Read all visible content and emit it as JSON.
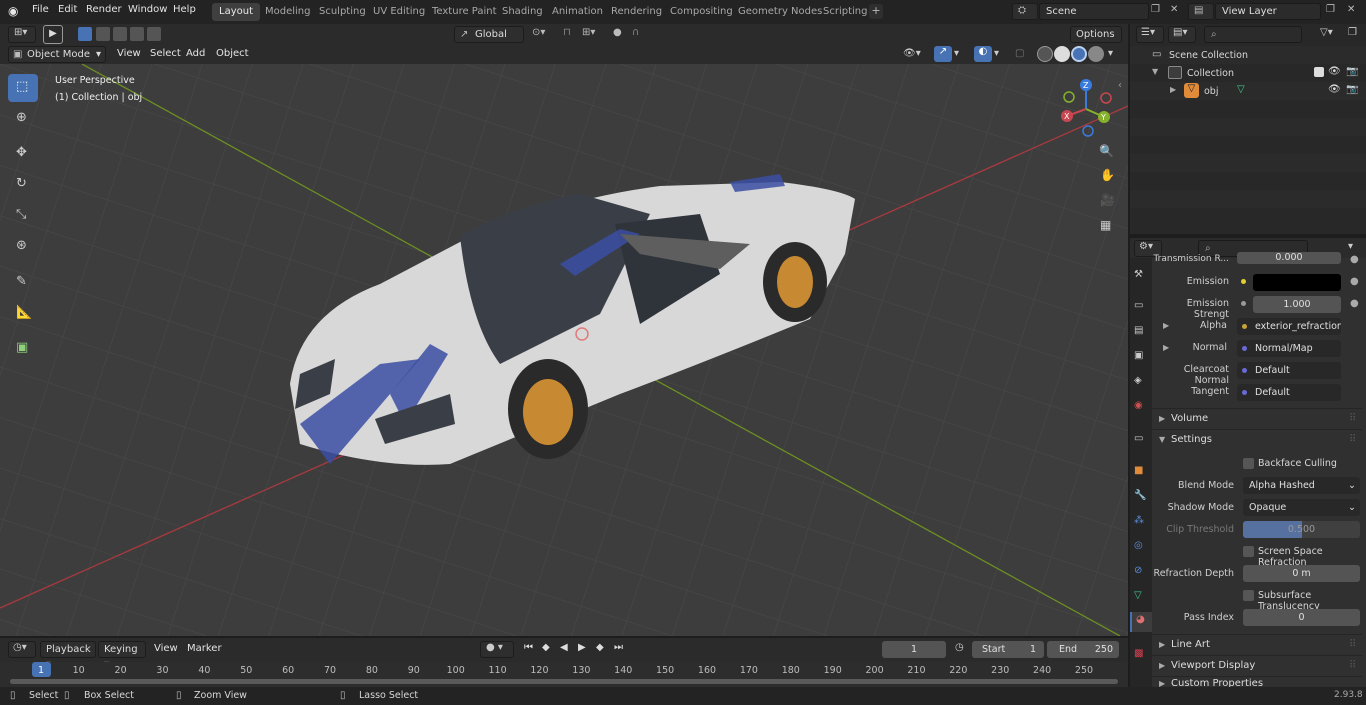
{
  "topbar": {
    "menus": [
      "File",
      "Edit",
      "Render",
      "Window",
      "Help"
    ],
    "workspaces": [
      "Layout",
      "Modeling",
      "Sculpting",
      "UV Editing",
      "Texture Paint",
      "Shading",
      "Animation",
      "Rendering",
      "Compositing",
      "Geometry Nodes",
      "Scripting"
    ],
    "active_workspace": "Layout",
    "scene": "Scene",
    "view_layer": "View Layer"
  },
  "viewport_header": {
    "mode": "Object Mode",
    "menus": [
      "View",
      "Select",
      "Add",
      "Object"
    ],
    "transform_orientation": "Global",
    "options": "Options"
  },
  "viewport": {
    "perspective_label": "User Perspective",
    "collection_label": "(1) Collection | obj",
    "gizmo_axes": {
      "z": "Z",
      "y": "Y",
      "x": "X"
    }
  },
  "outliner": {
    "root": "Scene Collection",
    "collection": "Collection",
    "object": "obj"
  },
  "properties": {
    "top_rows": [
      {
        "label": "Transmission R...",
        "value": "0.000"
      },
      {
        "label": "Emission",
        "value": ""
      },
      {
        "label": "Emission Strengt",
        "value": "1.000"
      }
    ],
    "link_rows": [
      {
        "label": "Alpha",
        "value": "exterior_refraction_i...",
        "dot": "#c7a23a"
      },
      {
        "label": "Normal",
        "value": "Normal/Map",
        "dot": "#6a6ad6"
      },
      {
        "label": "Clearcoat Normal",
        "value": "Default",
        "dot": "#6a6ad6"
      },
      {
        "label": "Tangent",
        "value": "Default",
        "dot": "#6a6ad6"
      }
    ],
    "sections": {
      "volume": "Volume",
      "settings": "Settings",
      "line_art": "Line Art",
      "viewport_display": "Viewport Display",
      "custom_properties": "Custom Properties"
    },
    "settings": {
      "backface_culling": "Backface Culling",
      "blend_mode_label": "Blend Mode",
      "blend_mode": "Alpha Hashed",
      "shadow_mode_label": "Shadow Mode",
      "shadow_mode": "Opaque",
      "clip_threshold_label": "Clip Threshold",
      "clip_threshold": "0.500",
      "ssr": "Screen Space Refraction",
      "refraction_depth_label": "Refraction Depth",
      "refraction_depth": "0 m",
      "subsurface": "Subsurface Translucency",
      "pass_index_label": "Pass Index",
      "pass_index": "0"
    }
  },
  "timeline": {
    "menus": [
      "Playback",
      "Keying",
      "View",
      "Marker"
    ],
    "current_frame": "1",
    "start_label": "Start",
    "start": "1",
    "end_label": "End",
    "end": "250",
    "ticks": [
      "1",
      "10",
      "20",
      "30",
      "40",
      "50",
      "60",
      "70",
      "80",
      "90",
      "100",
      "110",
      "120",
      "130",
      "140",
      "150",
      "160",
      "170",
      "180",
      "190",
      "200",
      "210",
      "220",
      "230",
      "240",
      "250"
    ]
  },
  "statusbar": {
    "select": "Select",
    "box_select": "Box Select",
    "zoom_view": "Zoom View",
    "lasso_select": "Lasso Select",
    "version": "2.93.8"
  },
  "colors": {
    "accent": "#4772b3",
    "x_axis": "#c8464f",
    "y_axis": "#86b12c",
    "z_axis": "#3a7be0"
  }
}
